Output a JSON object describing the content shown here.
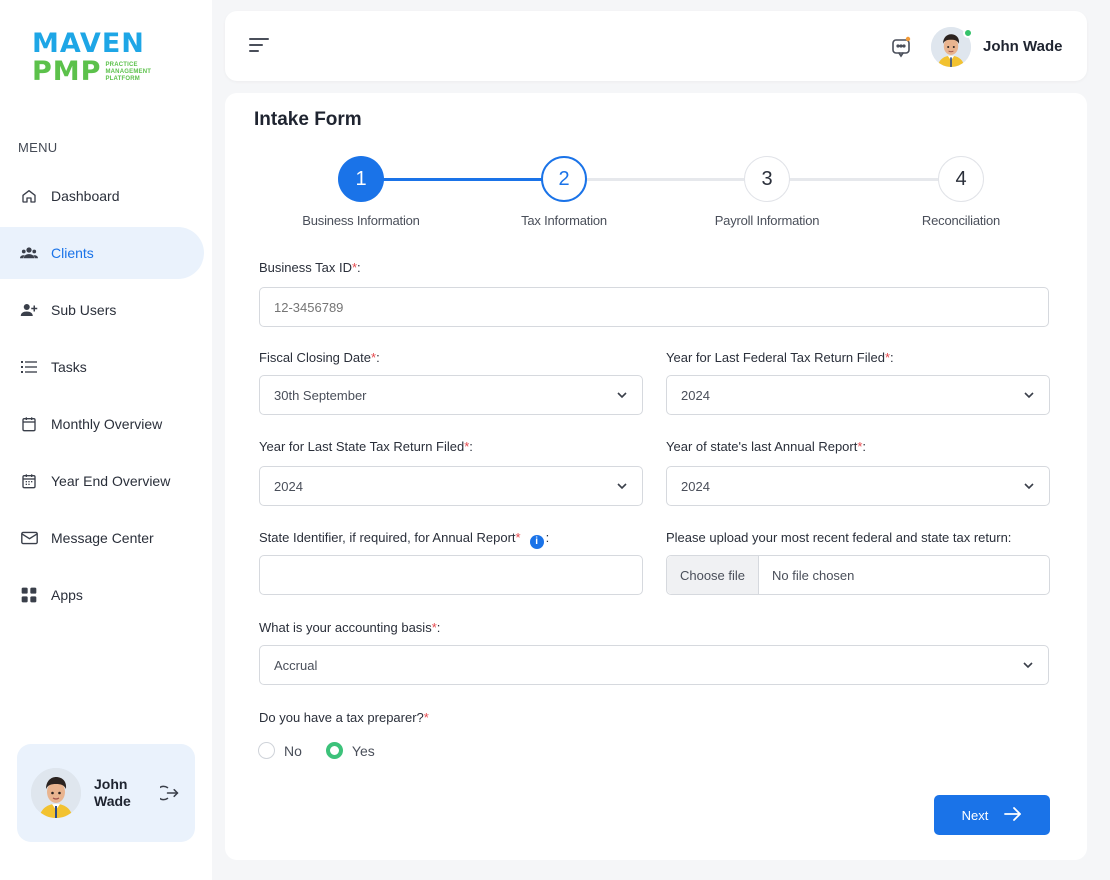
{
  "brand": {
    "line1": "MAVEN",
    "line2": "PMP",
    "tagline": "PRACTICE MANAGEMENT PLATFORM"
  },
  "sidebar": {
    "menu_title": "MENU",
    "items": [
      {
        "label": "Dashboard",
        "icon": "home-icon"
      },
      {
        "label": "Clients",
        "icon": "users-icon",
        "active": true
      },
      {
        "label": "Sub Users",
        "icon": "user-plus-icon"
      },
      {
        "label": "Tasks",
        "icon": "list-icon"
      },
      {
        "label": "Monthly Overview",
        "icon": "calendar-icon"
      },
      {
        "label": "Year End Overview",
        "icon": "calendar-grid-icon"
      },
      {
        "label": "Message Center",
        "icon": "mail-icon"
      },
      {
        "label": "Apps",
        "icon": "apps-icon"
      }
    ],
    "user": {
      "first": "John",
      "last": "Wade"
    }
  },
  "header": {
    "user_name": "John Wade"
  },
  "form": {
    "title": "Intake Form",
    "steps": [
      {
        "num": "1",
        "label": "Business Information",
        "state": "done"
      },
      {
        "num": "2",
        "label": "Tax Information",
        "state": "current"
      },
      {
        "num": "3",
        "label": "Payroll Information",
        "state": "pending"
      },
      {
        "num": "4",
        "label": "Reconciliation",
        "state": "pending"
      }
    ],
    "business_tax_id": {
      "label": "Business Tax ID",
      "placeholder": "12-3456789"
    },
    "fiscal_closing_date": {
      "label": "Fiscal Closing Date",
      "value": "30th September"
    },
    "federal_year": {
      "label": "Year for Last Federal Tax Return Filed",
      "value": "2024"
    },
    "state_year": {
      "label": "Year for Last State Tax Return Filed",
      "value": "2024"
    },
    "annual_report_year": {
      "label": "Year of state's last Annual Report",
      "value": "2024"
    },
    "state_identifier": {
      "label": "State Identifier, if required, for Annual Report",
      "value": ""
    },
    "upload": {
      "label": "Please upload your most recent federal and state tax return:",
      "button": "Choose file",
      "status": "No file chosen"
    },
    "accounting_basis": {
      "label": "What is your accounting basis",
      "value": "Accrual"
    },
    "tax_preparer": {
      "label": "Do you have a tax preparer?",
      "options": [
        "No",
        "Yes"
      ],
      "selected": "Yes"
    },
    "next_label": "Next"
  },
  "colors": {
    "primary": "#1a73e8",
    "accent_green": "#3cc27a",
    "required": "#e5484d"
  }
}
